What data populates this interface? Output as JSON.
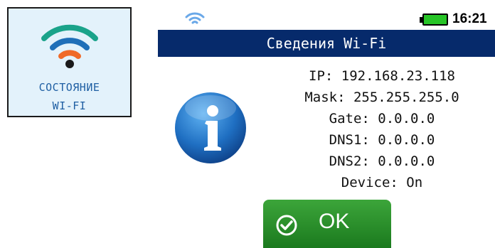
{
  "tile": {
    "line1": "СОСТОЯНИЕ",
    "line2": "WI-FI",
    "icon": "wifi-icon",
    "colors": {
      "arc1": "#1aa38a",
      "arc2": "#1f6fb8",
      "arc3": "#f06a28",
      "dot": "#1a1a1a"
    }
  },
  "statusbar": {
    "time": "16:21",
    "wifi_icon": "wifi-status-icon",
    "battery_icon": "battery-icon"
  },
  "dialog": {
    "title": "Сведения Wi-Fi",
    "lines": [
      "IP: 192.168.23.118",
      "Mask: 255.255.255.0",
      "Gate: 0.0.0.0",
      "DNS1: 0.0.0.0",
      "DNS2: 0.0.0.0",
      "Device: On"
    ],
    "info_icon": "info-icon",
    "ok_label": "OK"
  }
}
